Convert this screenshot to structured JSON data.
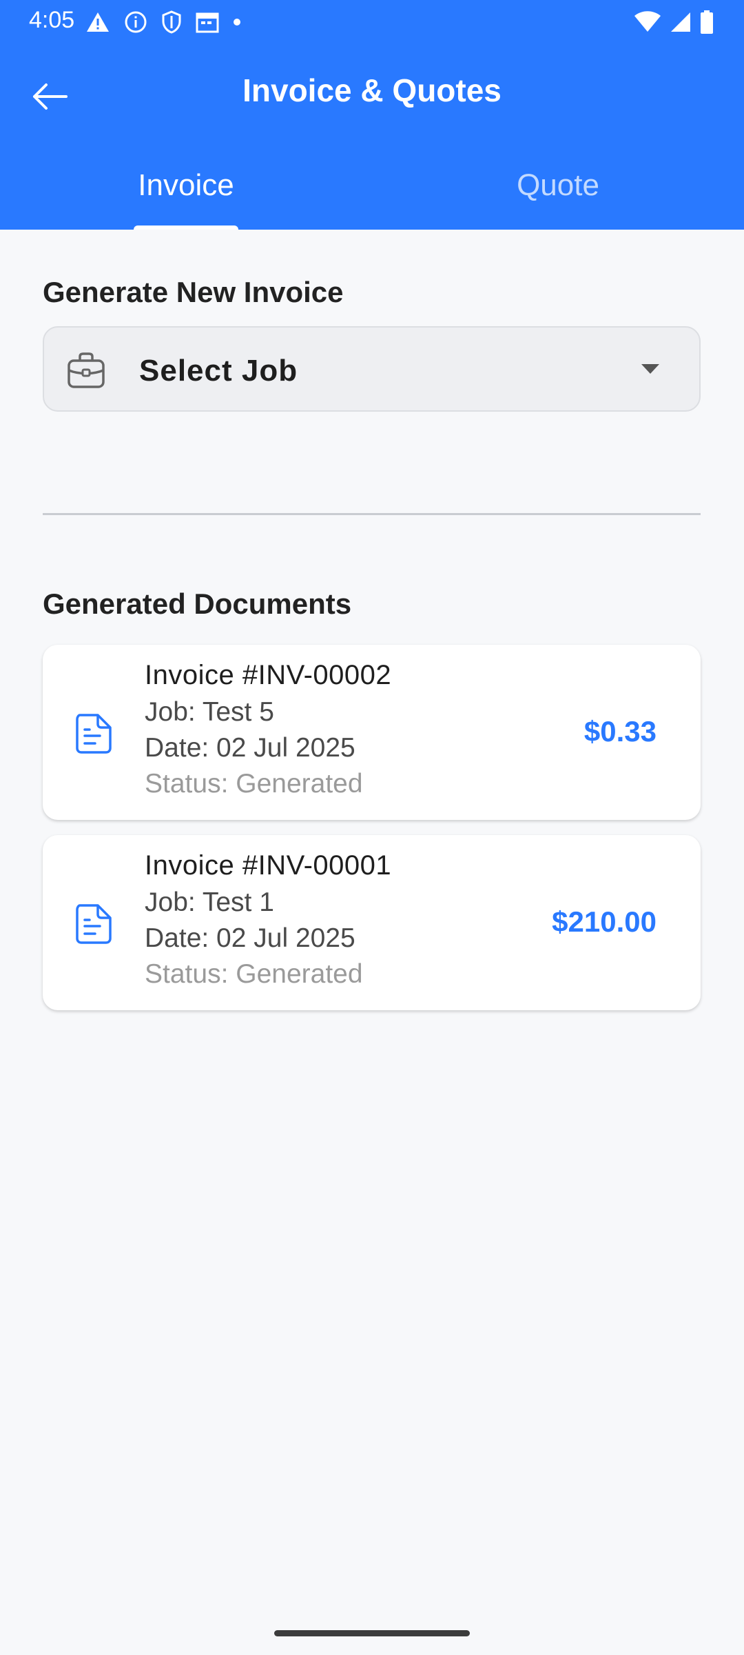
{
  "status_bar": {
    "time": "4:05",
    "left_icons": [
      "warning-icon",
      "info-icon",
      "shield-icon",
      "calendar-icon",
      "dot-icon"
    ],
    "right_icons": [
      "wifi-icon",
      "signal-icon",
      "battery-icon"
    ]
  },
  "app_bar": {
    "title": "Invoice & Quotes",
    "back_icon": "arrow-left-icon"
  },
  "tabs": [
    {
      "label": "Invoice",
      "active": true
    },
    {
      "label": "Quote",
      "active": false
    }
  ],
  "generate": {
    "title": "Generate New Invoice",
    "select_label": "Select Job",
    "select_icon": "briefcase-icon"
  },
  "documents": {
    "title": "Generated Documents",
    "items": [
      {
        "title": "Invoice #INV-00002",
        "job": "Job: Test 5",
        "date": "Date: 02 Jul 2025",
        "status": "Status: Generated",
        "amount": "$0.33"
      },
      {
        "title": "Invoice #INV-00001",
        "job": "Job: Test 1",
        "date": "Date: 02 Jul 2025",
        "status": "Status: Generated",
        "amount": "$210.00"
      }
    ]
  },
  "colors": {
    "primary": "#2979FF",
    "background": "#F7F8FA",
    "card": "#FFFFFF",
    "muted_text": "#9A9A9A"
  }
}
